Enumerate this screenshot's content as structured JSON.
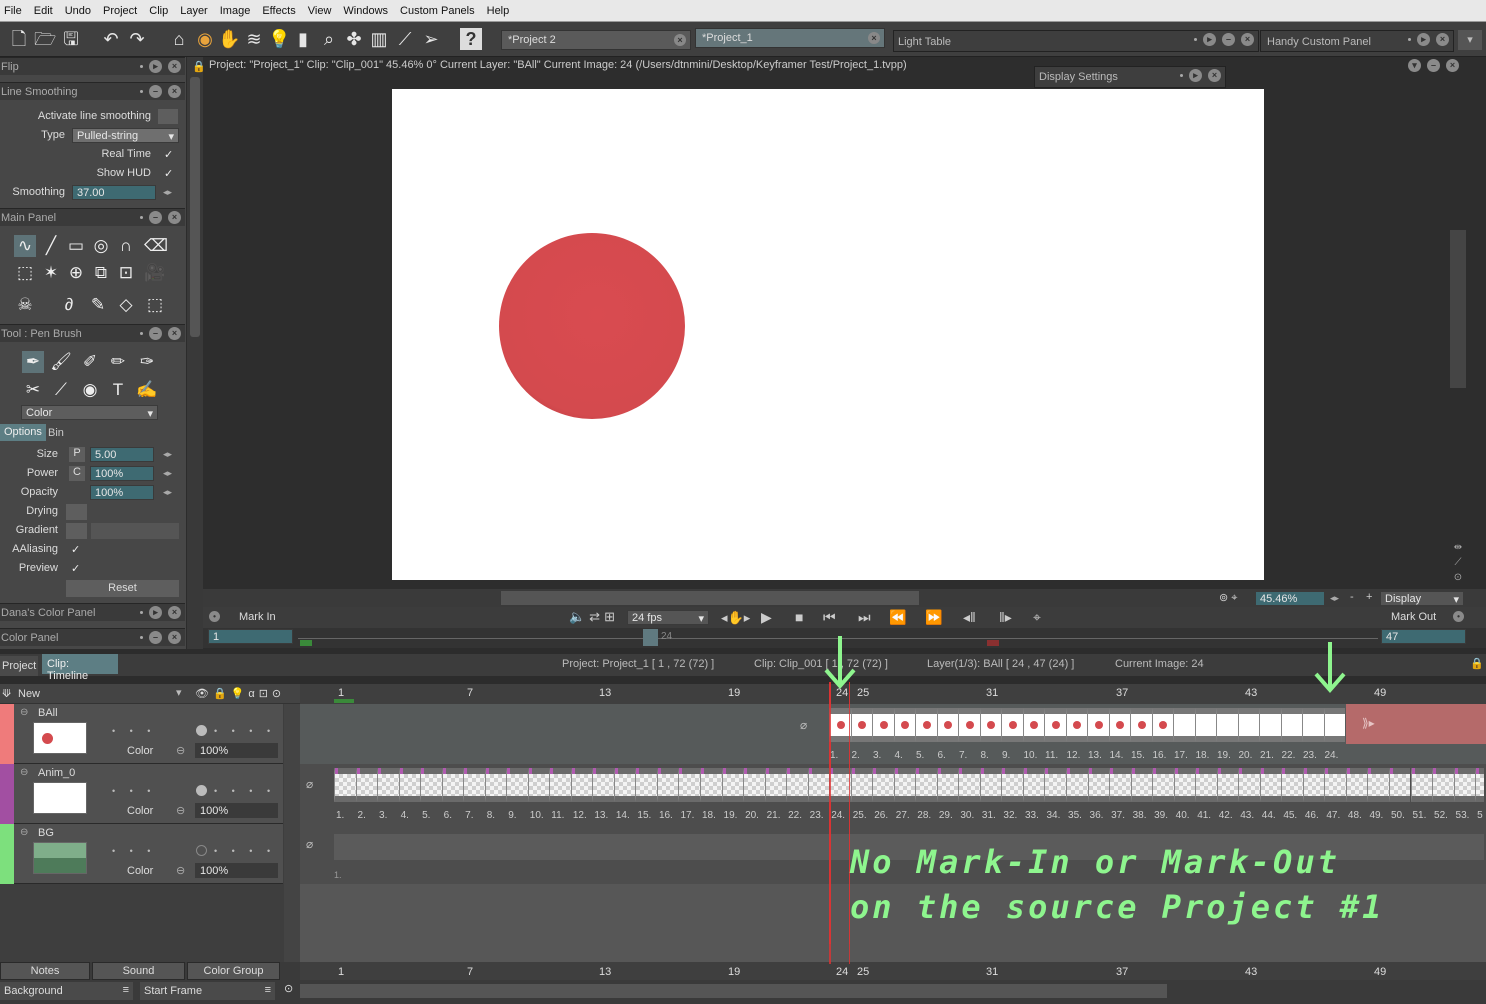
{
  "menu": [
    "File",
    "Edit",
    "Undo",
    "Project",
    "Clip",
    "Layer",
    "Image",
    "Effects",
    "View",
    "Windows",
    "Custom Panels",
    "Help"
  ],
  "tabs": {
    "project2": "*Project 2",
    "project1": "*Project_1",
    "light_table": "Light Table",
    "handy_panel": "Handy Custom Panel",
    "display_settings": "Display Settings"
  },
  "viewer": {
    "info": "Project:  \"Project_1\"  Clip: \"Clip_001\"   45.46%   0°  Current Layer: \"BAll\"  Current Image: 24 (/Users/dtnmini/Desktop/Keyframer Test/Project_1.tvpp)",
    "zoom": "45.46%",
    "display_select": "Display",
    "fps": "24 fps",
    "mark_in_label": "Mark In",
    "mark_out_label": "Mark Out",
    "mark_in_value": "1",
    "mark_out_value": "47",
    "ruler_current": "24",
    "zoom_minus": "-",
    "zoom_plus": "+"
  },
  "left": {
    "flip": "Flip",
    "line_smoothing": {
      "title": "Line Smoothing",
      "activate": "Activate line smoothing",
      "type_label": "Type",
      "type_value": "Pulled-string",
      "realtime": "Real Time",
      "showhud": "Show HUD",
      "smoothing_label": "Smoothing",
      "smoothing_value": "37.00"
    },
    "main_panel": "Main Panel",
    "tool_panel": {
      "title": "Tool : Pen Brush",
      "color_select": "Color",
      "tab_options": "Options",
      "tab_bin": "Bin",
      "size_label": "Size",
      "size_value": "5.00",
      "size_mode": "P",
      "power_label": "Power",
      "power_value": "100%",
      "power_mode": "C",
      "opacity_label": "Opacity",
      "opacity_value": "100%",
      "drying_label": "Drying",
      "gradient_label": "Gradient",
      "aaliasing_label": "AAliasing",
      "preview_label": "Preview",
      "reset": "Reset"
    },
    "danas_panel": "Dana's Color Panel",
    "color_panel": "Color Panel"
  },
  "timeline": {
    "tab_project": "Project",
    "tab_clip": "Clip: Timeline",
    "info_project": "Project: Project_1 [ 1 , 72  (72) ]",
    "info_clip": "Clip: Clip_001 [ 1 , 72  (72) ]",
    "info_layer": "Layer(1/3): BAll [ 24 , 47  (24) ]",
    "info_image": "Current Image: 24",
    "new_label": "New",
    "ruler_marks": [
      "1",
      "7",
      "13",
      "19",
      "24",
      "25",
      "31",
      "37",
      "43",
      "49"
    ],
    "layers": [
      {
        "name": "BAll",
        "color_label": "Color",
        "opacity": "100%"
      },
      {
        "name": "Anim_0",
        "color_label": "Color",
        "opacity": "100%"
      },
      {
        "name": "BG",
        "color_label": "Color",
        "opacity": "100%"
      }
    ],
    "ball_frame_nums": [
      "1.",
      "2.",
      "3.",
      "4.",
      "5.",
      "6.",
      "7.",
      "8.",
      "9.",
      "10.",
      "11.",
      "12.",
      "13.",
      "14.",
      "15.",
      "16.",
      "17.",
      "18.",
      "19.",
      "20.",
      "21.",
      "22.",
      "23.",
      "24."
    ],
    "anim_frame_nums": [
      "1.",
      "2.",
      "3.",
      "4.",
      "5.",
      "6.",
      "7.",
      "8.",
      "9.",
      "10.",
      "11.",
      "12.",
      "13.",
      "14.",
      "15.",
      "16.",
      "17.",
      "18.",
      "19.",
      "20.",
      "21.",
      "22.",
      "23.",
      "24.",
      "25.",
      "26.",
      "27.",
      "28.",
      "29.",
      "30.",
      "31.",
      "32.",
      "33.",
      "34.",
      "35.",
      "36.",
      "37.",
      "38.",
      "39.",
      "40.",
      "41.",
      "42.",
      "43.",
      "44.",
      "45.",
      "46.",
      "47.",
      "48.",
      "49.",
      "50.",
      "51.",
      "52.",
      "53.",
      "5"
    ],
    "bg_frame_num": "1.",
    "bottom_tabs": [
      "Notes",
      "Sound",
      "Color Group"
    ],
    "background_label": "Background",
    "start_frame_label": "Start Frame"
  },
  "annotation": {
    "line1": "No Mark-In or Mark-Out",
    "line2": "on the source Project #1"
  },
  "colors": {
    "ball": "#d44a4e",
    "annotation": "#8ef58e",
    "playhead": "#d33"
  }
}
